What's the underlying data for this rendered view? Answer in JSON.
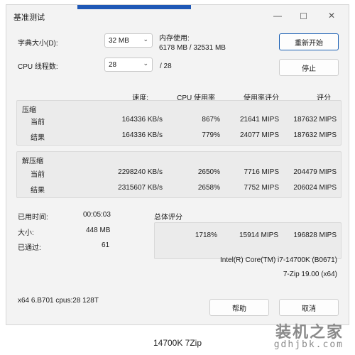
{
  "window": {
    "title": "基准测试"
  },
  "settings": {
    "dict_label": "字典大小(D):",
    "dict_value": "32 MB",
    "mem_label": "内存使用:",
    "mem_value": "6178 MB / 32531 MB",
    "threads_label": "CPU 线程数:",
    "threads_value": "28",
    "threads_total": "/ 28"
  },
  "buttons": {
    "restart": "重新开始",
    "stop": "停止",
    "help": "帮助",
    "cancel": "取消"
  },
  "columns": [
    "速度:",
    "CPU 使用率",
    "使用率评分",
    "评分"
  ],
  "compress": {
    "label": "压缩",
    "rows": [
      {
        "name": "当前",
        "speed": "164336 KB/s",
        "cpu": "867%",
        "usage": "21641 MIPS",
        "rating": "187632 MIPS"
      },
      {
        "name": "结果",
        "speed": "164336 KB/s",
        "cpu": "779%",
        "usage": "24077 MIPS",
        "rating": "187632 MIPS"
      }
    ]
  },
  "decompress": {
    "label": "解压缩",
    "rows": [
      {
        "name": "当前",
        "speed": "2298240 KB/s",
        "cpu": "2650%",
        "usage": "7716 MIPS",
        "rating": "204479 MIPS"
      },
      {
        "name": "结果",
        "speed": "2315607 KB/s",
        "cpu": "2658%",
        "usage": "7752 MIPS",
        "rating": "206024 MIPS"
      }
    ]
  },
  "stats": {
    "elapsed_label": "已用时间:",
    "elapsed_value": "00:05:03",
    "size_label": "大小:",
    "size_value": "448 MB",
    "passes_label": "已通过:",
    "passes_value": "61"
  },
  "total": {
    "label": "总体评分",
    "cpu": "1718%",
    "usage": "15914 MIPS",
    "rating": "196828 MIPS"
  },
  "system": {
    "cpu_name": "Intel(R) Core(TM) i7-14700K (B0671)",
    "version": "7-Zip 19.00 (x64)",
    "arch": "x64 6.B701 cpus:28 128T"
  },
  "caption": "14700K 7Zip",
  "watermark": {
    "cn": "装机之家",
    "url": "gdhjbk.com"
  }
}
